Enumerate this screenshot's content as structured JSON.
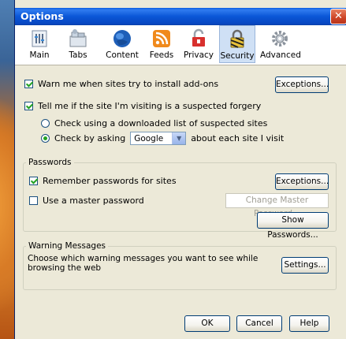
{
  "window": {
    "title": "Options",
    "close_symbol": "✕"
  },
  "toolbar": {
    "items": [
      {
        "label": "Main",
        "icon": "main-icon"
      },
      {
        "label": "Tabs",
        "icon": "tabs-icon"
      },
      {
        "label": "Content",
        "icon": "content-icon"
      },
      {
        "label": "Feeds",
        "icon": "feeds-icon"
      },
      {
        "label": "Privacy",
        "icon": "privacy-icon"
      },
      {
        "label": "Security",
        "icon": "security-icon",
        "selected": true
      },
      {
        "label": "Advanced",
        "icon": "advanced-icon"
      }
    ]
  },
  "security": {
    "warn_addons_label": "Warn me when sites try to install add-ons",
    "warn_addons_checked": true,
    "exceptions_label": "Exceptions...",
    "forgery_label": "Tell me if the site I'm visiting is a suspected forgery",
    "forgery_checked": true,
    "check_downloaded_label": "Check using a downloaded list of suspected sites",
    "check_asking_label": "Check by asking",
    "provider_value": "Google",
    "check_asking_suffix": "about each site I visit"
  },
  "passwords": {
    "group_label": "Passwords",
    "remember_label": "Remember passwords for sites",
    "remember_checked": true,
    "exceptions_label": "Exceptions...",
    "master_label": "Use a master password",
    "master_checked": false,
    "change_master_label": "Change Master Password...",
    "show_passwords_label": "Show Passwords..."
  },
  "warnings": {
    "group_label": "Warning Messages",
    "description": "Choose which warning messages you want to see while browsing the web",
    "settings_label": "Settings..."
  },
  "footer": {
    "ok_label": "OK",
    "cancel_label": "Cancel",
    "help_label": "Help"
  },
  "colors": {
    "titlebar": "#0a56d6",
    "dialog_bg": "#ece9d8",
    "selected_tab": "#cfe0f5"
  }
}
